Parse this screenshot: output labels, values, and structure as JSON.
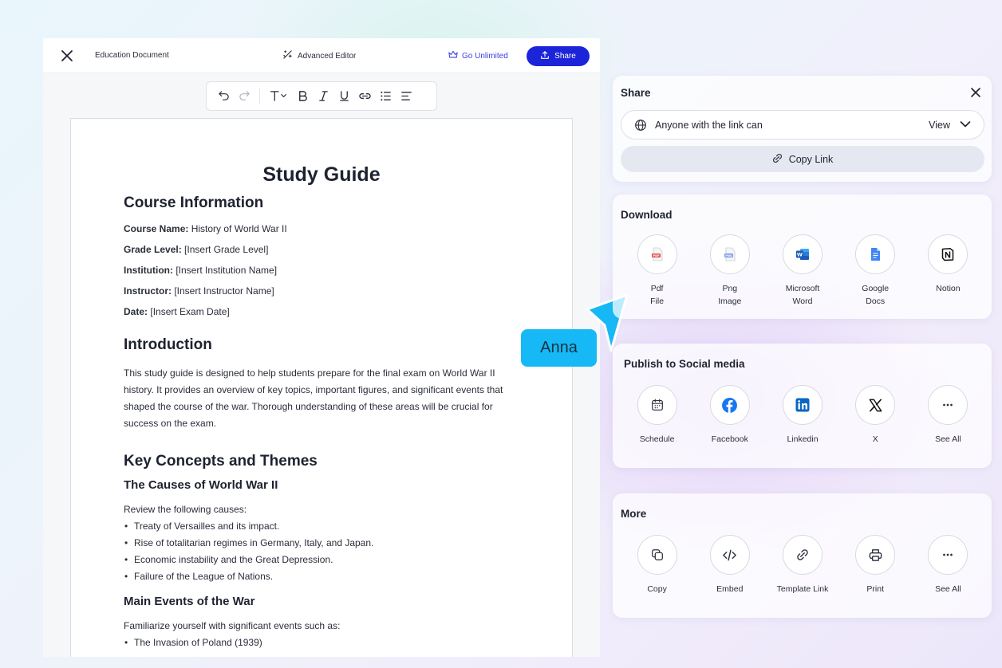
{
  "editor": {
    "doc_name": "Education Document",
    "advanced_editor_label": "Advanced Editor",
    "go_unlimited_label": "Go Unlimited",
    "share_label": "Share"
  },
  "document": {
    "title": "Study Guide",
    "course_info_heading": "Course Information",
    "fields": [
      {
        "label": "Course Name:",
        "value": "History of World War II"
      },
      {
        "label": "Grade Level:",
        "value": "[Insert Grade Level]"
      },
      {
        "label": "Institution:",
        "value": "[Insert Institution Name]"
      },
      {
        "label": "Instructor:",
        "value": "[Insert Instructor Name]"
      },
      {
        "label": "Date:",
        "value": "[Insert Exam Date]"
      }
    ],
    "intro_heading": "Introduction",
    "intro_text": "This study guide is designed to help students prepare for the final exam on World War II history. It provides an overview of key topics, important figures, and significant events that shaped the course of the war. Thorough understanding of these areas will be crucial for success on the exam.",
    "concepts_heading": "Key Concepts and Themes",
    "causes_heading": "The Causes of World War II",
    "causes_intro": "Review the following causes:",
    "causes": [
      "Treaty of Versailles and its impact.",
      "Rise of totalitarian regimes in Germany, Italy, and Japan.",
      "Economic instability and the Great Depression.",
      "Failure of the League of Nations."
    ],
    "events_heading": "Main Events of the War",
    "events_intro": "Familiarize yourself with significant events such as:",
    "events": [
      "The Invasion of Poland (1939)"
    ]
  },
  "cursor": {
    "name": "Anna",
    "color": "#16b9f5"
  },
  "share_panel": {
    "title": "Share",
    "access_text": "Anyone with the link can",
    "permission": "View",
    "copy_link_label": "Copy Link"
  },
  "download_panel": {
    "title": "Download",
    "items": [
      {
        "icon": "pdf-file-icon",
        "line1": "Pdf",
        "line2": "File"
      },
      {
        "icon": "png-image-icon",
        "line1": "Png",
        "line2": "Image"
      },
      {
        "icon": "microsoft-word-icon",
        "line1": "Microsoft",
        "line2": "Word"
      },
      {
        "icon": "google-docs-icon",
        "line1": "Google",
        "line2": "Docs"
      },
      {
        "icon": "notion-icon",
        "line1": "Notion",
        "line2": ""
      }
    ]
  },
  "social_panel": {
    "title": "Publish to Social media",
    "items": [
      {
        "icon": "calendar-icon",
        "label": "Schedule"
      },
      {
        "icon": "facebook-icon",
        "label": "Facebook"
      },
      {
        "icon": "linkedin-icon",
        "label": "Linkedin"
      },
      {
        "icon": "x-icon",
        "label": "X"
      },
      {
        "icon": "more-horizontal-icon",
        "label": "See All"
      }
    ]
  },
  "more_panel": {
    "title": "More",
    "items": [
      {
        "icon": "copy-icon",
        "label": "Copy"
      },
      {
        "icon": "embed-code-icon",
        "label": "Embed"
      },
      {
        "icon": "link-icon",
        "label": "Template Link"
      },
      {
        "icon": "printer-icon",
        "label": "Print"
      },
      {
        "icon": "more-horizontal-icon",
        "label": "See All"
      }
    ]
  },
  "colors": {
    "primary": "#1b24d8",
    "accent_link": "#3b3fe0",
    "word_blue": "#185abd",
    "docs_blue": "#4285f4",
    "pdf_red": "#e2574c",
    "facebook_blue": "#1877f2",
    "linkedin_blue": "#0a66c2"
  }
}
